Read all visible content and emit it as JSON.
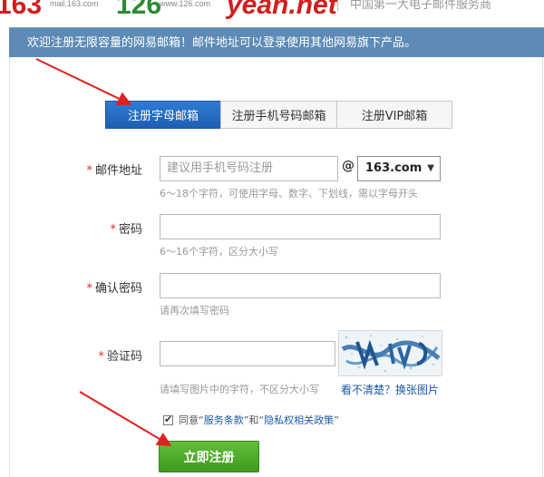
{
  "logos": {
    "logo_163": "163",
    "sub_163": "mail.163.com",
    "logo_126": "126",
    "sub_126": "www.126.com",
    "logo_yeah": "yeah.net",
    "strip_text": "中国第一大电子邮件服务商"
  },
  "info_bar": {
    "text": "欢迎注册无限容量的网易邮箱！邮件地址可以登录使用其他网易旗下产品。"
  },
  "tabs": [
    {
      "label": "注册字母邮箱",
      "active": true
    },
    {
      "label": "注册手机号码邮箱",
      "active": false
    },
    {
      "label": "注册VIP邮箱",
      "active": false
    }
  ],
  "form": {
    "required_mark": "*",
    "email": {
      "label": "邮件地址",
      "placeholder": "建议用手机号码注册",
      "at": "@",
      "domain": "163.com",
      "hint": "6～18个字符，可使用字母、数字、下划线，需以字母开头"
    },
    "password": {
      "label": "密码",
      "hint": "6～16个字符，区分大小写"
    },
    "confirm": {
      "label": "确认密码",
      "hint": "请再次填写密码"
    },
    "captcha": {
      "label": "验证码",
      "hint": "请填写图片中的字符，不区分大小写",
      "refresh_link": "看不清楚？换张图片"
    },
    "agreement": {
      "checked": true,
      "prefix": "同意“",
      "terms": "服务条款",
      "middle": "”和“",
      "privacy": "隐私权相关政策",
      "suffix": "”"
    },
    "submit_label": "立即注册"
  },
  "colors": {
    "info_bar": "#5d8bb6",
    "tab_active": "#1e5fb3",
    "submit": "#4aa82a",
    "required": "#d92d2d",
    "link": "#1b5aa6",
    "annotation_arrow": "#e02020"
  }
}
